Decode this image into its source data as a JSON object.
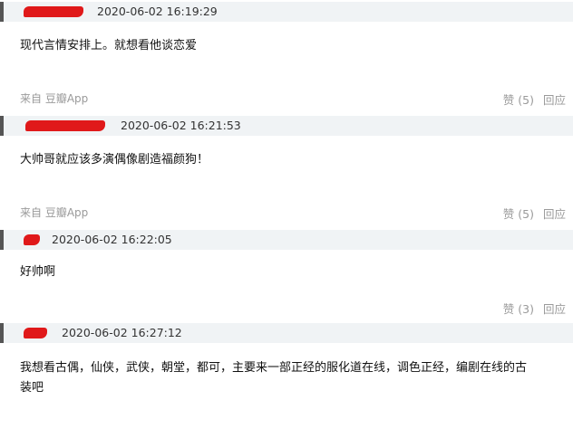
{
  "comments": [
    {
      "timestamp": "2020-06-02 16:19:29",
      "text": "现代言情安排上。就想看他谈恋爱",
      "source": "来自 豆瓣App",
      "like": "赞 (5)",
      "reply": "回应"
    },
    {
      "timestamp": "2020-06-02 16:21:53",
      "text": "大帅哥就应该多演偶像剧造福颜狗！",
      "source": "来自 豆瓣App",
      "like": "赞 (5)",
      "reply": "回应"
    },
    {
      "timestamp": "2020-06-02 16:22:05",
      "text": "好帅啊",
      "like": "赞 (3)",
      "reply": "回应"
    },
    {
      "timestamp": "2020-06-02 16:27:12",
      "text_line1": "我想看古偶，仙侠，武侠，朝堂，都可，主要来一部正经的服化道在线，调色正经，编剧在线的古",
      "text_line2": "装吧"
    }
  ],
  "colors": {
    "header_bg": "#f0f3f5",
    "redaction": "#e0191a",
    "muted": "#9a9a9a"
  }
}
